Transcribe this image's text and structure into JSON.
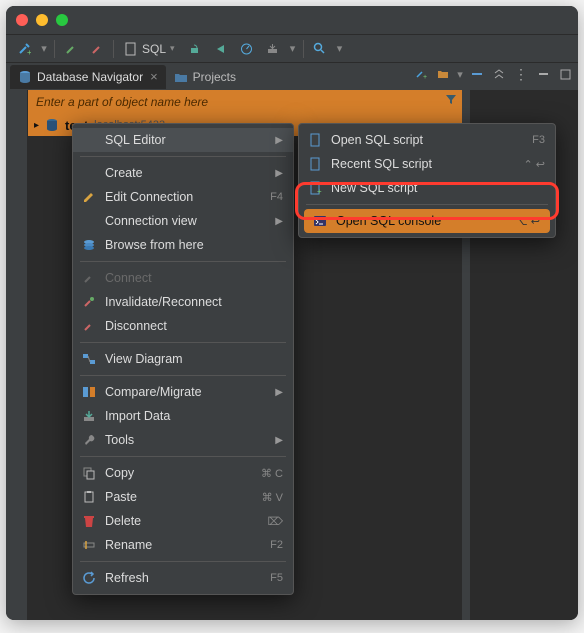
{
  "toolbar": {
    "sql_label": "SQL"
  },
  "panels": {
    "nav_tab": "Database Navigator",
    "projects_tab": "Projects"
  },
  "filter": {
    "placeholder": "Enter a part of object name here"
  },
  "tree": {
    "db_name": "test",
    "db_host": "localhost:5433"
  },
  "menu": {
    "sql_editor": "SQL Editor",
    "create": "Create",
    "edit_connection": "Edit Connection",
    "edit_connection_sc": "F4",
    "connection_view": "Connection view",
    "browse_from_here": "Browse from here",
    "connect": "Connect",
    "invalidate": "Invalidate/Reconnect",
    "disconnect": "Disconnect",
    "view_diagram": "View Diagram",
    "compare": "Compare/Migrate",
    "import_data": "Import Data",
    "tools": "Tools",
    "copy": "Copy",
    "copy_sc": "⌘ C",
    "paste": "Paste",
    "paste_sc": "⌘ V",
    "delete": "Delete",
    "delete_sc": "⌦",
    "rename": "Rename",
    "rename_sc": "F2",
    "refresh": "Refresh",
    "refresh_sc": "F5"
  },
  "submenu": {
    "open_script": "Open SQL script",
    "open_script_sc": "F3",
    "recent_script": "Recent SQL script",
    "recent_script_sc": "⌃  ↩",
    "new_script": "New SQL script",
    "open_console": "Open SQL console",
    "open_console_sc": "⌃ ⌥ ↩"
  },
  "colors": {
    "accent": "#d47e2a",
    "highlight": "#ff3b2f"
  }
}
